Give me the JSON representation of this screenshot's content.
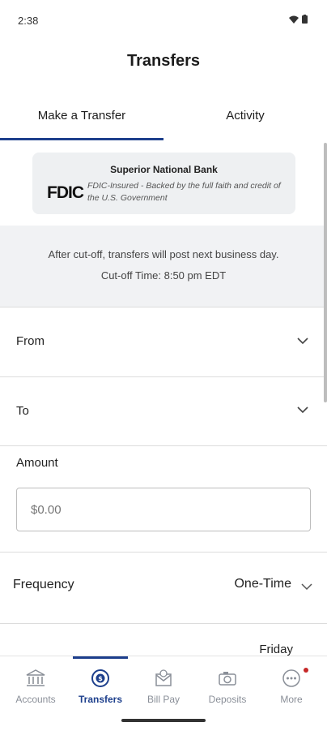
{
  "status_bar": {
    "time": "2:38"
  },
  "header": {
    "title": "Transfers"
  },
  "tabs": [
    {
      "label": "Make a Transfer",
      "active": true
    },
    {
      "label": "Activity",
      "active": false
    }
  ],
  "fdic": {
    "bank_name": "Superior National Bank",
    "logo_text": "FDIC",
    "text": "FDIC-Insured - Backed by the full faith and credit of the U.S. Government"
  },
  "cutoff": {
    "line1": "After cut-off, transfers will post next business day.",
    "line2": "Cut-off Time: 8:50 pm EDT"
  },
  "form": {
    "from_label": "From",
    "to_label": "To",
    "amount_label": "Amount",
    "amount_placeholder": "$0.00",
    "frequency_label": "Frequency",
    "frequency_value": "One-Time",
    "date_value": "Friday"
  },
  "nav": {
    "items": [
      {
        "label": "Accounts",
        "icon": "bank-icon"
      },
      {
        "label": "Transfers",
        "icon": "transfer-icon",
        "active": true
      },
      {
        "label": "Bill Pay",
        "icon": "bill-pay-icon"
      },
      {
        "label": "Deposits",
        "icon": "deposit-icon"
      },
      {
        "label": "More",
        "icon": "more-icon",
        "badge": true
      }
    ]
  },
  "colors": {
    "accent": "#1d3f8c",
    "badge": "#c62828",
    "muted": "#8a8f98"
  }
}
